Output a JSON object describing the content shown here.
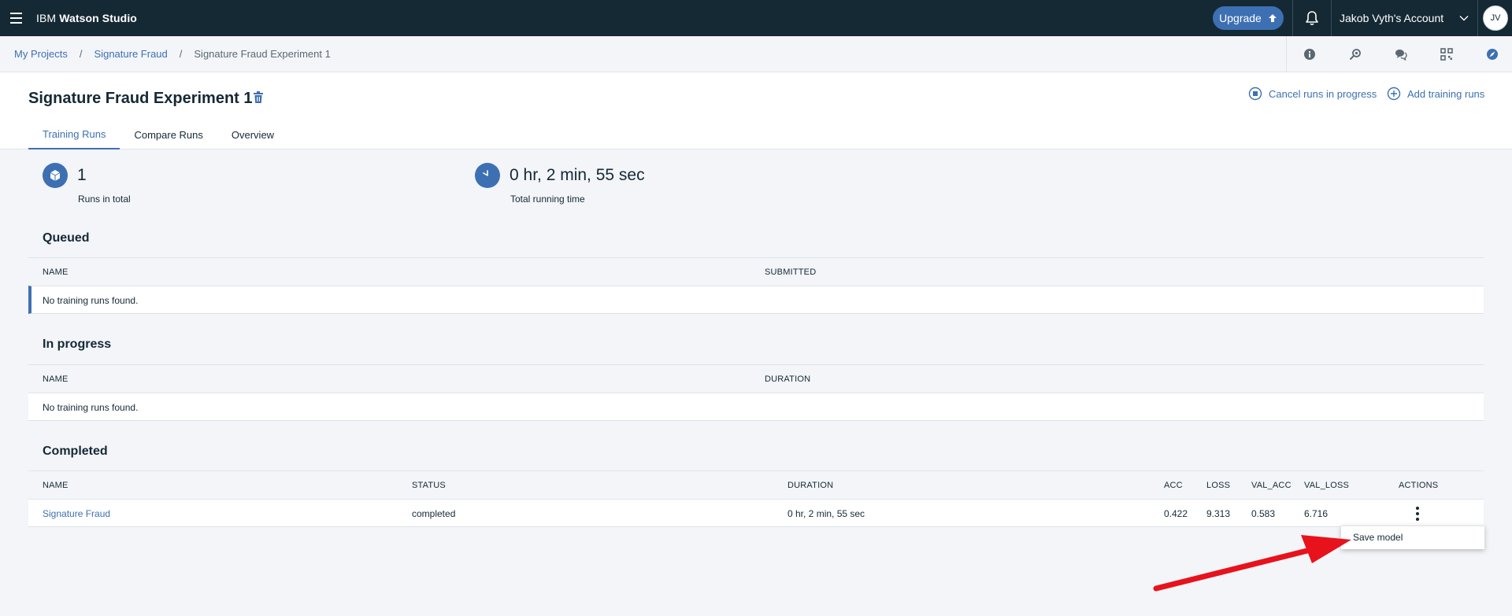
{
  "header": {
    "brand_prefix": "IBM ",
    "brand_name": "Watson Studio",
    "upgrade_label": "Upgrade",
    "account_label": "Jakob Vyth's Account",
    "avatar_initials": "JV",
    "background_color": "#152934"
  },
  "breadcrumb": {
    "items": [
      "My Projects",
      "Signature Fraud",
      "Signature Fraud Experiment 1"
    ],
    "separator": "/"
  },
  "page": {
    "title": "Signature Fraud Experiment 1",
    "actions": {
      "cancel_label": "Cancel runs in progress",
      "add_label": "Add training runs"
    },
    "tabs": [
      "Training Runs",
      "Compare Runs",
      "Overview"
    ],
    "active_tab": "Training Runs"
  },
  "stats": {
    "runs_value": "1",
    "runs_label": "Runs in total",
    "time_value": "0 hr, 2 min, 55 sec",
    "time_label": "Total running time"
  },
  "queued": {
    "title": "Queued",
    "columns": [
      "NAME",
      "SUBMITTED"
    ],
    "empty_text": "No training runs found."
  },
  "in_progress": {
    "title": "In progress",
    "columns": [
      "NAME",
      "DURATION"
    ],
    "empty_text": "No training runs found."
  },
  "completed": {
    "title": "Completed",
    "columns": [
      "NAME",
      "STATUS",
      "DURATION",
      "ACC",
      "LOSS",
      "VAL_ACC",
      "VAL_LOSS",
      "ACTIONS"
    ],
    "rows": [
      {
        "name": "Signature Fraud",
        "status": "completed",
        "duration": "0 hr, 2 min, 55 sec",
        "acc": "0.422",
        "loss": "9.313",
        "val_acc": "0.583",
        "val_loss": "6.716"
      }
    ]
  },
  "menu": {
    "items": [
      "Save model"
    ]
  },
  "colors": {
    "accent": "#3d70b2",
    "annotation_arrow": "#e8121c"
  }
}
